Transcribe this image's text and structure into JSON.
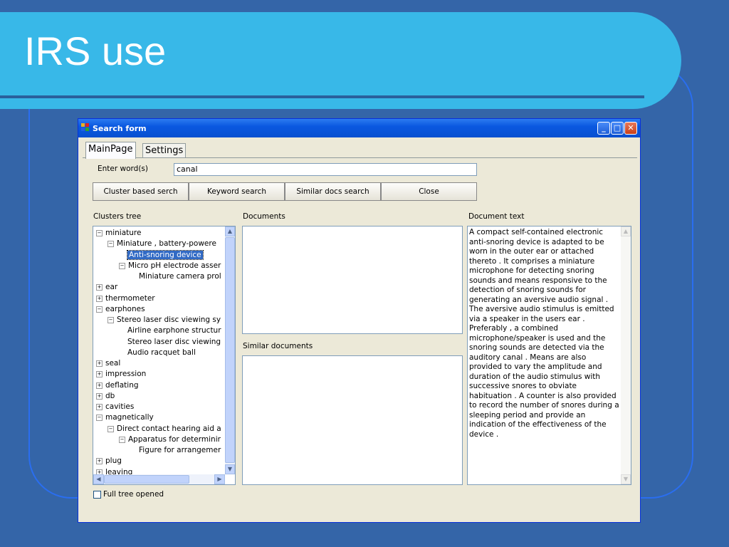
{
  "slide": {
    "title": "IRS use"
  },
  "window": {
    "title": "Search form",
    "minimize_glyph": "_",
    "maximize_glyph": "□",
    "close_glyph": "✕"
  },
  "tabs": [
    {
      "label": "MainPage",
      "active": true
    },
    {
      "label": "Settings",
      "active": false
    }
  ],
  "search": {
    "label": "Enter word(s)",
    "value": "canal"
  },
  "buttons": {
    "cluster": "Cluster based serch",
    "keyword": "Keyword search",
    "similar": "Similar docs search",
    "close": "Close"
  },
  "panels": {
    "clusters_label": "Clusters tree",
    "documents_label": "Documents",
    "similar_label": "Similar documents",
    "doc_text_label": "Document text"
  },
  "tree": [
    {
      "label": "miniature",
      "level": 0,
      "expander": "−"
    },
    {
      "label": "Miniature , battery-powere",
      "level": 1,
      "expander": "−"
    },
    {
      "label": "Anti-snoring device",
      "level": 2,
      "expander": "",
      "selected": true
    },
    {
      "label": "Micro pH electrode asser",
      "level": 2,
      "expander": "−"
    },
    {
      "label": "Miniature camera prol",
      "level": 3,
      "expander": ""
    },
    {
      "label": "ear",
      "level": 0,
      "expander": "+"
    },
    {
      "label": "thermometer",
      "level": 0,
      "expander": "+"
    },
    {
      "label": "earphones",
      "level": 0,
      "expander": "−"
    },
    {
      "label": "Stereo laser disc viewing sy",
      "level": 1,
      "expander": "−"
    },
    {
      "label": "Airline earphone structur",
      "level": 2,
      "expander": ""
    },
    {
      "label": "Stereo laser disc viewing",
      "level": 2,
      "expander": ""
    },
    {
      "label": "Audio racquet ball",
      "level": 2,
      "expander": ""
    },
    {
      "label": "seal",
      "level": 0,
      "expander": "+"
    },
    {
      "label": "impression",
      "level": 0,
      "expander": "+"
    },
    {
      "label": "deflating",
      "level": 0,
      "expander": "+"
    },
    {
      "label": "db",
      "level": 0,
      "expander": "+"
    },
    {
      "label": "cavities",
      "level": 0,
      "expander": "+"
    },
    {
      "label": "magnetically",
      "level": 0,
      "expander": "−"
    },
    {
      "label": "Direct contact hearing aid a",
      "level": 1,
      "expander": "−"
    },
    {
      "label": "Apparatus for determinir",
      "level": 2,
      "expander": "−"
    },
    {
      "label": "Figure for arrangemer",
      "level": 3,
      "expander": ""
    },
    {
      "label": "plug",
      "level": 0,
      "expander": "+"
    },
    {
      "label": "leaving",
      "level": 0,
      "expander": "+"
    }
  ],
  "document_text": "A compact self-contained electronic anti-snoring device is adapted to be worn in the outer ear or attached thereto .  It comprises a miniature microphone for detecting snoring sounds and means responsive to the detection of snoring sounds for generating an aversive audio signal . The aversive audio stimulus is emitted via a speaker in the users ear . Preferably , a combined microphone/speaker is used and the snoring sounds are detected via the auditory canal .  Means are also provided to vary the amplitude and duration of the audio stimulus with successive snores to obviate habituation .  A counter is also provided to record the number of snores during a sleeping period and provide an indication of the effectiveness of the device .",
  "footer": {
    "full_tree_label": "Full tree opened",
    "full_tree_checked": false
  },
  "colors": {
    "slide_bg": "#3465a8",
    "title_band": "#38b8e8",
    "selection": "#316ac5"
  }
}
